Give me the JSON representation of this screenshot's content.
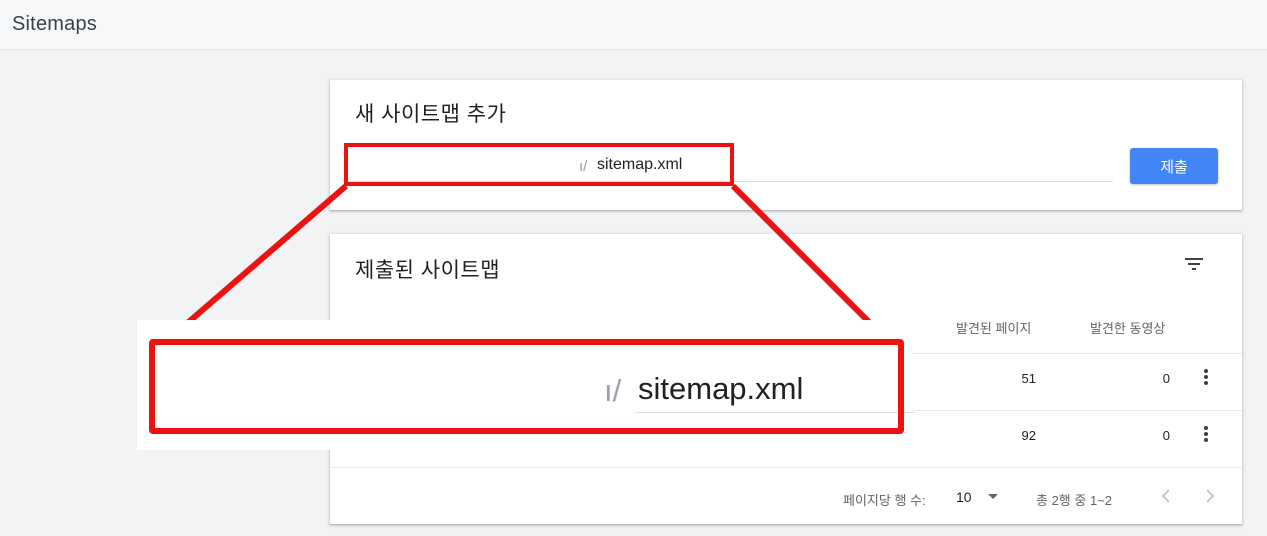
{
  "page": {
    "title": "Sitemaps"
  },
  "add_card": {
    "title": "새 사이트맵 추가",
    "url_prefix": "ı/",
    "url_value": "sitemap.xml",
    "submit_label": "제출"
  },
  "list_card": {
    "title": "제출된 사이트맵",
    "columns": {
      "discovered_pages": "발견된 페이지",
      "discovered_videos": "발견한 동영상"
    },
    "rows": [
      {
        "discovered_pages": "51",
        "discovered_videos": "0"
      },
      {
        "discovered_pages": "92",
        "discovered_videos": "0"
      }
    ],
    "footer": {
      "rows_per_page_label": "페이지당 행 수:",
      "rows_per_page_value": "10",
      "range_text": "총 2행 중 1~2"
    }
  },
  "zoom_callout": {
    "prefix": "ı/",
    "text": "sitemap.xml"
  },
  "colors": {
    "accent_blue": "#4285f4",
    "highlight_red": "#ee1111",
    "background": "#f1f3f4"
  },
  "icons": [
    "filter-icon",
    "more-vert-icon",
    "arrow-drop-down-icon",
    "chevron-left-icon",
    "chevron-right-icon"
  ]
}
